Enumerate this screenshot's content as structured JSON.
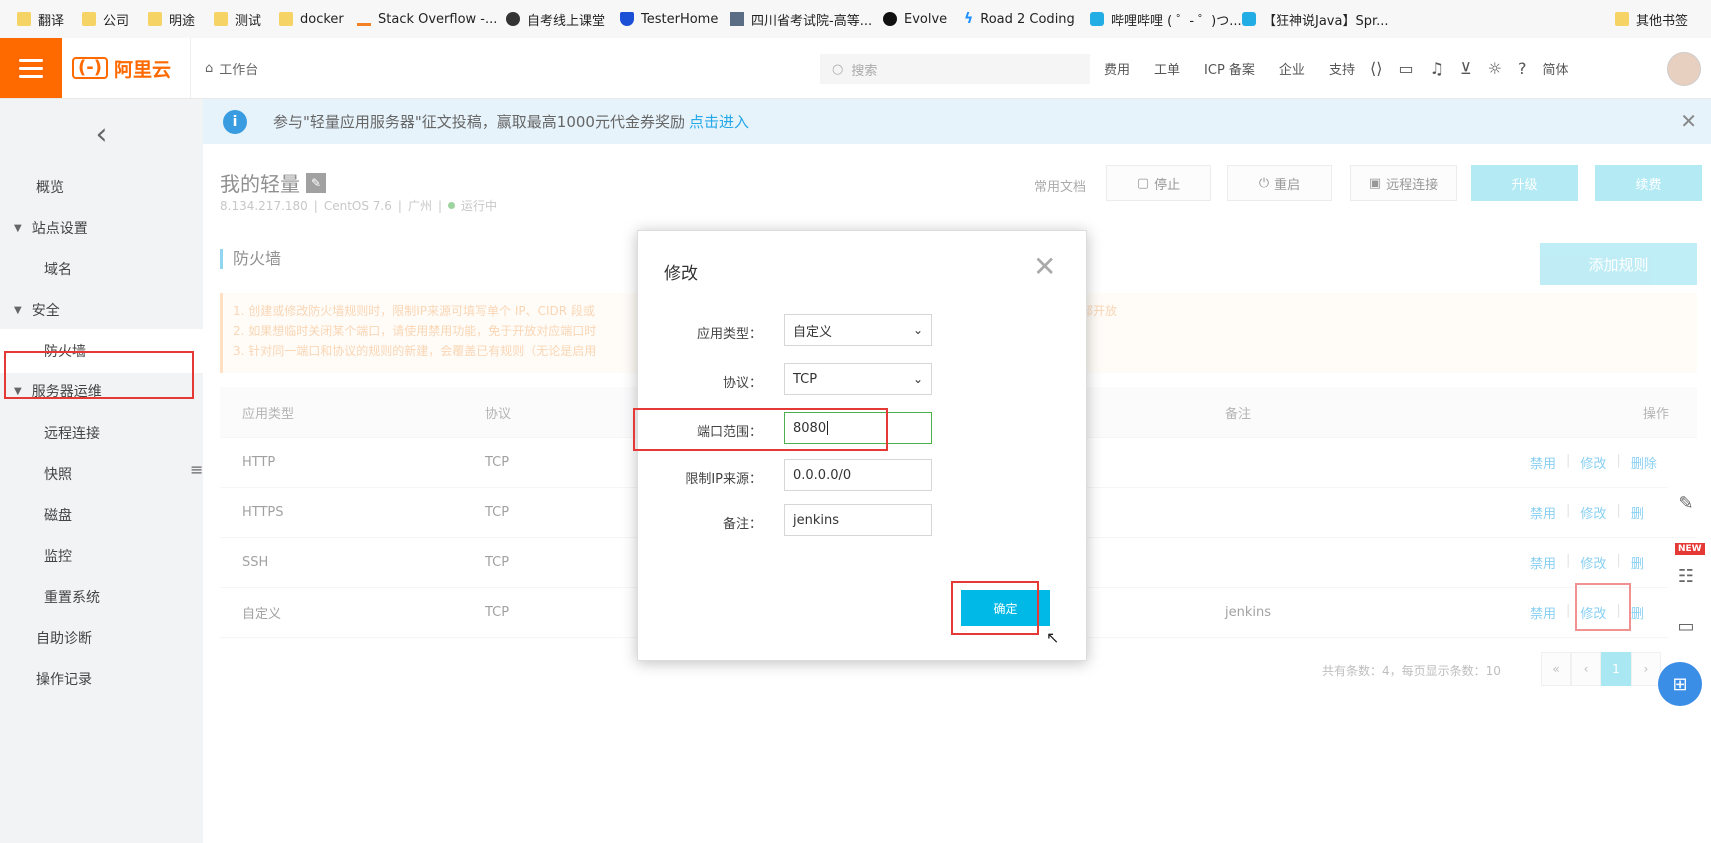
{
  "bookmarks": [
    {
      "label": "翻译",
      "icon": "folder-icon"
    },
    {
      "label": "公司",
      "icon": "folder-icon"
    },
    {
      "label": "明途",
      "icon": "folder-icon"
    },
    {
      "label": "测试",
      "icon": "folder-icon"
    },
    {
      "label": "docker",
      "icon": "folder-icon"
    },
    {
      "label": "Stack Overflow -...",
      "icon": "stackoverflow-icon"
    },
    {
      "label": "自考线上课堂",
      "icon": "globe-icon"
    },
    {
      "label": "TesterHome",
      "icon": "shield-icon"
    },
    {
      "label": "四川省考试院-高等...",
      "icon": "site-icon"
    },
    {
      "label": "Evolve",
      "icon": "evolve-icon"
    },
    {
      "label": "Road 2 Coding",
      "icon": "road-icon"
    },
    {
      "label": "哔哩哔哩 ( ゜- ゜)つ...",
      "icon": "bilibili-icon"
    },
    {
      "label": "【狂神说Java】Spr...",
      "icon": "bilibili-icon"
    },
    {
      "label": "其他书签",
      "icon": "folder-icon"
    }
  ],
  "topnav": {
    "logo_text": "阿里云",
    "logo_mark": "(-)",
    "workbench": "工作台",
    "search_placeholder": "搜索",
    "links": [
      "费用",
      "工单",
      "ICP 备案",
      "企业",
      "支持"
    ],
    "language": "简体"
  },
  "sidebar": {
    "items": [
      {
        "label": "概览",
        "level": 1
      },
      {
        "label": "站点设置",
        "level": 0
      },
      {
        "label": "域名",
        "level": 2
      },
      {
        "label": "安全",
        "level": 0
      },
      {
        "label": "防火墙",
        "level": 2,
        "active": true
      },
      {
        "label": "服务器运维",
        "level": 0
      },
      {
        "label": "远程连接",
        "level": 2
      },
      {
        "label": "快照",
        "level": 2
      },
      {
        "label": "磁盘",
        "level": 2
      },
      {
        "label": "监控",
        "level": 2
      },
      {
        "label": "重置系统",
        "level": 2
      },
      {
        "label": "自助诊断",
        "level": 1
      },
      {
        "label": "操作记录",
        "level": 1
      }
    ]
  },
  "notice": {
    "text": "参与\"轻量应用服务器\"征文投稿，赢取最高1000元代金券奖励",
    "link": "点击进入"
  },
  "server": {
    "name": "我的轻量",
    "ip": "8.134.217.180",
    "os": "CentOS 7.6",
    "region": "广州",
    "status": "运行中"
  },
  "actions": {
    "docs": "常用文档",
    "stop": "停止",
    "restart": "重启",
    "remote": "远程连接",
    "upgrade": "升级",
    "renew": "续费"
  },
  "firewall": {
    "title": "防火墙",
    "add_rule": "添加规则",
    "tips": [
      "1. 创建或修改防火墙规则时，限制IP来源可填写单个 IP、CIDR 段或",
      "2. 如果想临时关闭某个端口，请使用禁用功能，免于开放对应端口时",
      "3. 针对同一端口和协议的规则的新建，会覆盖已有规则（无论是启用"
    ],
    "tips_tail": "部开放",
    "columns": {
      "type": "应用类型",
      "protocol": "协议",
      "remark": "备注",
      "ops": "操作"
    },
    "rows": [
      {
        "type": "HTTP",
        "protocol": "TCP",
        "remark": ""
      },
      {
        "type": "HTTPS",
        "protocol": "TCP",
        "remark": ""
      },
      {
        "type": "SSH",
        "protocol": "TCP",
        "remark": ""
      },
      {
        "type": "自定义",
        "protocol": "TCP",
        "remark": "jenkins"
      }
    ],
    "op_labels": {
      "disable": "禁用",
      "edit": "修改",
      "delete": "删除"
    },
    "op_partial": {
      "delete_clipped": "删"
    },
    "pagination": {
      "summary": "共有条数：4，每页显示条数：10",
      "first": "«",
      "prev": "‹",
      "current": "1",
      "next": "›"
    }
  },
  "right_tools": {
    "new_badge": "NEW"
  },
  "modal": {
    "title": "修改",
    "fields": {
      "app_type": {
        "label": "应用类型：",
        "value": "自定义"
      },
      "protocol": {
        "label": "协议：",
        "value": "TCP"
      },
      "port_range": {
        "label": "端口范围：",
        "value": "8080"
      },
      "ip_source": {
        "label": "限制IP来源：",
        "value": "0.0.0.0/0"
      },
      "remark": {
        "label": "备注：",
        "value": "jenkins"
      }
    },
    "confirm": "确定"
  },
  "colors": {
    "brand": "#ff6a00",
    "accent": "#00b9e6",
    "highlight_red": "#e53935"
  }
}
